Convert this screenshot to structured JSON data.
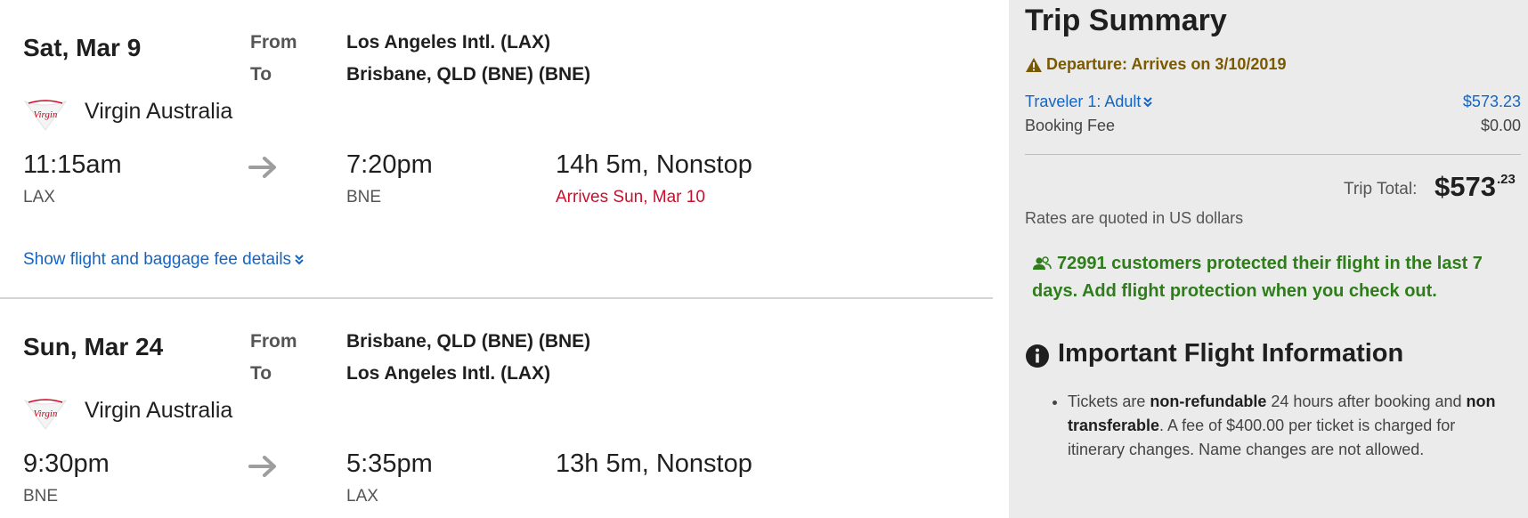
{
  "legs": [
    {
      "date": "Sat, Mar 9",
      "from_label": "From",
      "to_label": "To",
      "from": "Los Angeles Intl. (LAX)",
      "to": "Brisbane, QLD (BNE) (BNE)",
      "airline": "Virgin Australia",
      "airline_logo_text": "Virgin",
      "depart_time": "11:15am",
      "depart_code": "LAX",
      "arrive_time": "7:20pm",
      "arrive_code": "BNE",
      "duration": "14h 5m, Nonstop",
      "arrival_note": "Arrives Sun, Mar 10",
      "details_link": "Show flight and baggage fee details"
    },
    {
      "date": "Sun, Mar 24",
      "from_label": "From",
      "to_label": "To",
      "from": "Brisbane, QLD (BNE) (BNE)",
      "to": "Los Angeles Intl. (LAX)",
      "airline": "Virgin Australia",
      "airline_logo_text": "Virgin",
      "depart_time": "9:30pm",
      "depart_code": "BNE",
      "arrive_time": "5:35pm",
      "arrive_code": "LAX",
      "duration": "13h 5m, Nonstop"
    }
  ],
  "summary": {
    "title": "Trip Summary",
    "departure_warning": "Departure: Arrives on 3/10/2019",
    "traveler_label": "Traveler 1: Adult",
    "traveler_price": "$573.23",
    "booking_fee_label": "Booking Fee",
    "booking_fee_value": "$0.00",
    "trip_total_label": "Trip Total:",
    "trip_total_whole": "$573",
    "trip_total_cents": ".23",
    "rates_note": "Rates are quoted in US dollars",
    "protection_message": "72991 customers protected their flight in the last 7 days. Add flight protection when you check out.",
    "important_title": "Important Flight Information",
    "bullet": {
      "p1": "Tickets are ",
      "b1": "non-refundable",
      "p2": " 24 hours after booking and ",
      "b2": "non transferable",
      "p3": ". A fee of $400.00 per ticket is charged for itinerary changes. Name changes are not allowed."
    }
  },
  "colors": {
    "link_blue": "#1565c0",
    "arrival_red": "#c8102e",
    "protect_green": "#2e7d1a",
    "warning_brown": "#7a5a00",
    "panel_gray": "#ebebeb"
  },
  "icons": {
    "airline_logo": "virgin-australia-logo",
    "arrow": "right-arrow-icon",
    "chevron": "double-chevron-down-icon",
    "warning": "warning-triangle-icon",
    "people": "people-icon",
    "info": "info-circle-icon"
  }
}
